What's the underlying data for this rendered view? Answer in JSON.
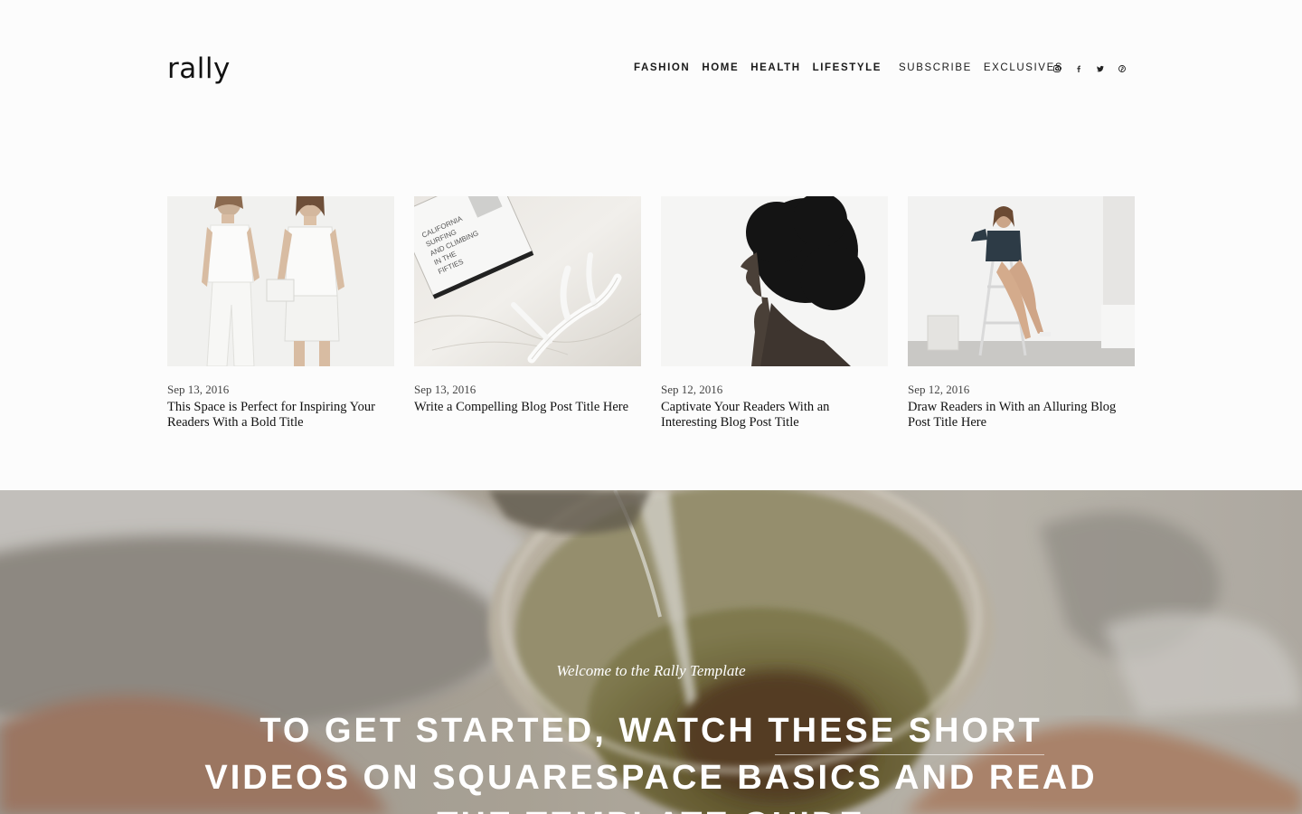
{
  "header": {
    "logo": "rally",
    "nav": [
      {
        "label": "Fashion"
      },
      {
        "label": "Home"
      },
      {
        "label": "Health"
      },
      {
        "label": "Lifestyle"
      },
      {
        "label": "Subscribe"
      },
      {
        "label": "Exclusives"
      }
    ],
    "social": [
      "instagram-icon",
      "facebook-icon",
      "twitter-icon",
      "pinterest-icon"
    ]
  },
  "posts": [
    {
      "date": "Sep 13, 2016",
      "title": "This Space is Perfect for Inspiring Your Readers With a Bold Title"
    },
    {
      "date": "Sep 13, 2016",
      "title": "Write a Compelling Blog Post Title Here"
    },
    {
      "date": "Sep 12, 2016",
      "title": "Captivate Your Readers With an Interesting Blog Post Title"
    },
    {
      "date": "Sep 12, 2016",
      "title": "Draw Readers in With an Alluring Blog Post Title Here"
    }
  ],
  "hero": {
    "kicker": "Welcome to the Rally Template",
    "title": "To get started, watch these short videos on Squarespace basics and read the template guide"
  },
  "colors": {
    "background": "#fcfcfc",
    "text": "#1a1a1a",
    "hero_text": "#ffffff"
  }
}
